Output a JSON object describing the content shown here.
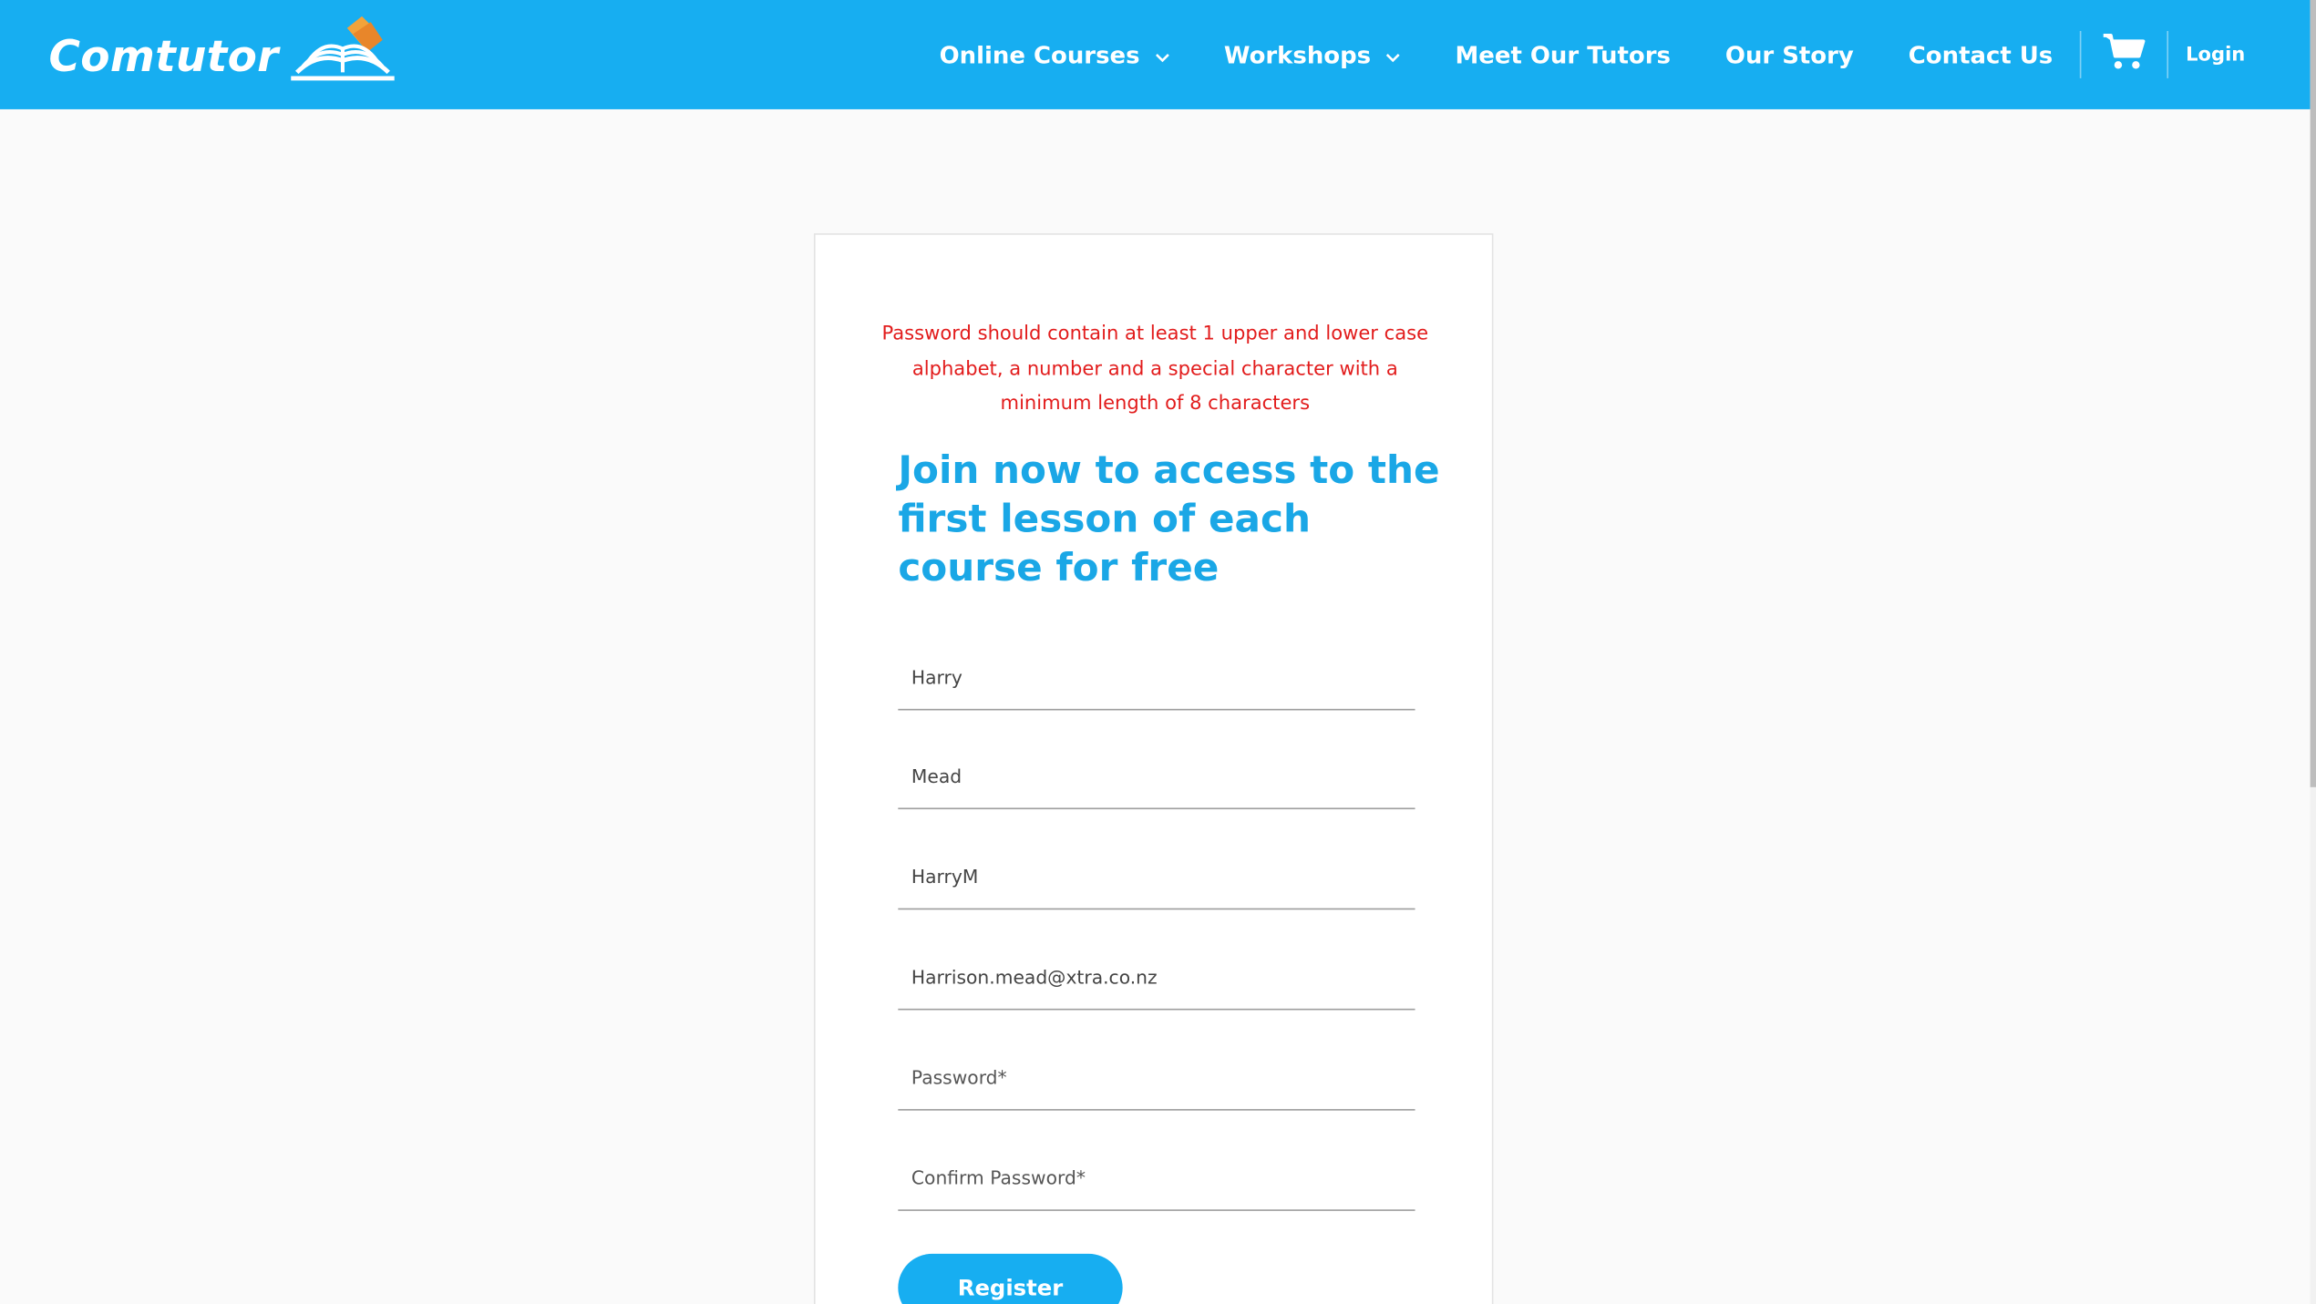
{
  "brand": {
    "name": "Comtutor",
    "logo_icon": "open-book-icon",
    "color": "#17aef1"
  },
  "nav": {
    "items": [
      {
        "label": "Online Courses",
        "has_dropdown": true
      },
      {
        "label": "Workshops",
        "has_dropdown": true
      },
      {
        "label": "Meet Our Tutors",
        "has_dropdown": false
      },
      {
        "label": "Our Story",
        "has_dropdown": false
      },
      {
        "label": "Contact Us",
        "has_dropdown": false
      }
    ],
    "cart_icon": "shopping-cart-icon",
    "login_label": "Login"
  },
  "form": {
    "error_message": "Password should contain at least 1 upper and lower case alphabet, a number and a special character with a minimum length of 8 characters",
    "error_color": "#e21c1c",
    "heading": "Join now to access to the first lesson of each course for free",
    "heading_color": "#1aa7e6",
    "fields": [
      {
        "name": "first-name",
        "value": "Harry",
        "placeholder": ""
      },
      {
        "name": "last-name",
        "value": "Mead",
        "placeholder": ""
      },
      {
        "name": "username",
        "value": "HarryM",
        "placeholder": ""
      },
      {
        "name": "email",
        "value": "Harrison.mead@xtra.co.nz",
        "placeholder": ""
      },
      {
        "name": "password",
        "value": "",
        "placeholder": "Password*"
      },
      {
        "name": "confirm-password",
        "value": "",
        "placeholder": "Confirm Password*"
      }
    ],
    "submit_label": "Register"
  }
}
